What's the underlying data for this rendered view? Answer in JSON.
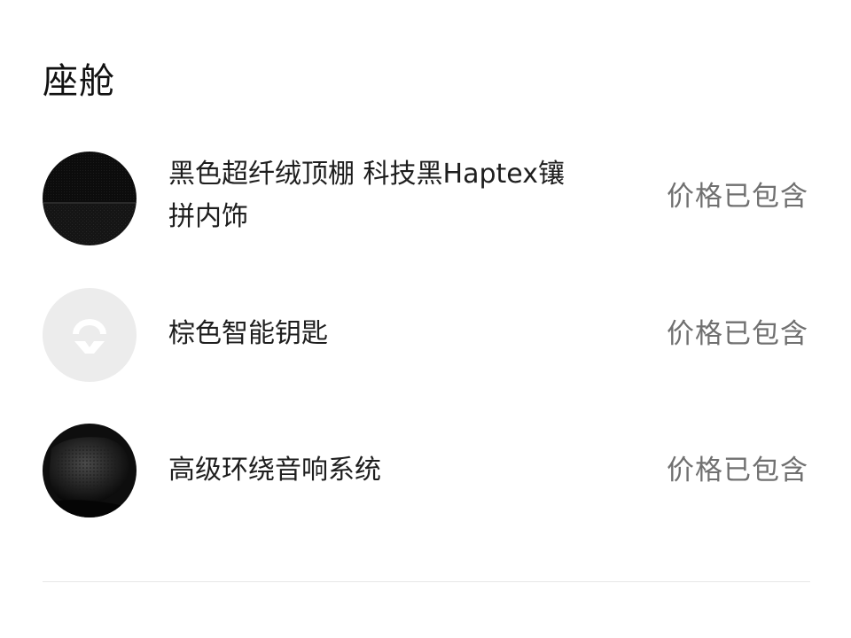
{
  "section": {
    "title": "座舱"
  },
  "items": [
    {
      "name": "黑色超纤绒顶棚 科技黑Haptex镶拼内饰",
      "price_status": "价格已包含",
      "thumbnail": "black-fabric-swatch"
    },
    {
      "name": "棕色智能钥匙",
      "price_status": "价格已包含",
      "thumbnail": "nio-logo-key"
    },
    {
      "name": "高级环绕音响系统",
      "price_status": "价格已包含",
      "thumbnail": "speaker-grille"
    }
  ],
  "colors": {
    "title": "#111111",
    "item_text": "#1e1e1e",
    "price_text": "#707070",
    "divider": "#e6e6e6",
    "key_thumb_bg": "#ececec"
  }
}
